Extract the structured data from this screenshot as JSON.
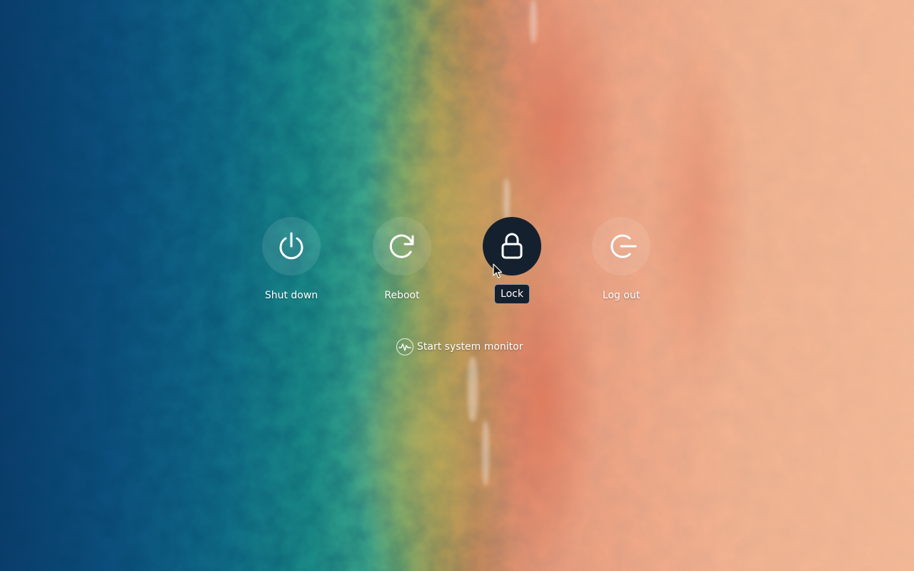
{
  "background": {
    "description_colors": {
      "ocean": "#0c4f7d",
      "shallows": "#1a8a86",
      "sand": "#f0b290"
    }
  },
  "power_menu": {
    "actions": [
      {
        "id": "shutdown",
        "label": "Shut down",
        "icon": "power-icon",
        "active": false
      },
      {
        "id": "reboot",
        "label": "Reboot",
        "icon": "reboot-icon",
        "active": false
      },
      {
        "id": "lock",
        "label": "Lock",
        "icon": "lock-icon",
        "active": true
      },
      {
        "id": "logout",
        "label": "Log out",
        "icon": "logout-icon",
        "active": false
      }
    ],
    "system_monitor": {
      "label": "Start system monitor",
      "icon": "system-monitor-icon"
    }
  },
  "colors": {
    "active_button_bg": "#15202f",
    "text": "#ffffff"
  }
}
